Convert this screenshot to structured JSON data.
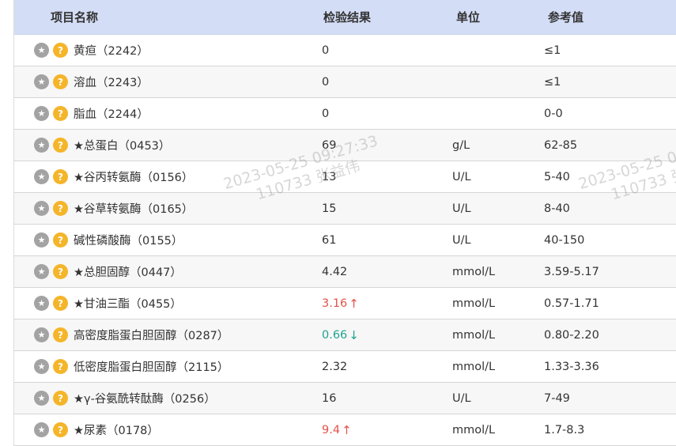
{
  "table": {
    "headers": [
      "项目名称",
      "检验结果",
      "单位",
      "参考值"
    ],
    "rows": [
      {
        "name": "黄疸（2242）",
        "result": "0",
        "flag": "",
        "unit": "",
        "ref": "≤1"
      },
      {
        "name": "溶血（2243）",
        "result": "0",
        "flag": "",
        "unit": "",
        "ref": "≤1"
      },
      {
        "name": "脂血（2244）",
        "result": "0",
        "flag": "",
        "unit": "",
        "ref": "0-0"
      },
      {
        "name": "★总蛋白（0453）",
        "result": "69",
        "flag": "",
        "unit": "g/L",
        "ref": "62-85"
      },
      {
        "name": "★谷丙转氨酶（0156）",
        "result": "13",
        "flag": "",
        "unit": "U/L",
        "ref": "5-40"
      },
      {
        "name": "★谷草转氨酶（0165）",
        "result": "15",
        "flag": "",
        "unit": "U/L",
        "ref": "8-40"
      },
      {
        "name": "碱性磷酸酶（0155）",
        "result": "61",
        "flag": "",
        "unit": "U/L",
        "ref": "40-150"
      },
      {
        "name": "★总胆固醇（0447）",
        "result": "4.42",
        "flag": "",
        "unit": "mmol/L",
        "ref": "3.59-5.17"
      },
      {
        "name": "★甘油三酯（0455）",
        "result": "3.16",
        "flag": "high",
        "unit": "mmol/L",
        "ref": "0.57-1.71"
      },
      {
        "name": "高密度脂蛋白胆固醇（0287）",
        "result": "0.66",
        "flag": "low",
        "unit": "mmol/L",
        "ref": "0.80-2.20"
      },
      {
        "name": "低密度脂蛋白胆固醇（2115）",
        "result": "2.32",
        "flag": "",
        "unit": "mmol/L",
        "ref": "1.33-3.36"
      },
      {
        "name": "★γ-谷氨酰转酞酶（0256）",
        "result": "16",
        "flag": "",
        "unit": "U/L",
        "ref": "7-49"
      },
      {
        "name": "★尿素（0178）",
        "result": "9.4",
        "flag": "high",
        "unit": "mmol/L",
        "ref": "1.7-8.3"
      }
    ]
  },
  "icons": {
    "row_left": "star-icon",
    "row_right": "help-icon"
  },
  "arrows": {
    "high": "↑",
    "low": "↓"
  },
  "colors": {
    "header_bg": "#d4ddf6",
    "high": "#e5534b",
    "low": "#21a38f",
    "star_icon": "#a3a3a3",
    "help_icon": "#f5b52a"
  },
  "watermark": {
    "line1": "2023-05-25 09:27:33",
    "line2": "110733 张益伟"
  }
}
